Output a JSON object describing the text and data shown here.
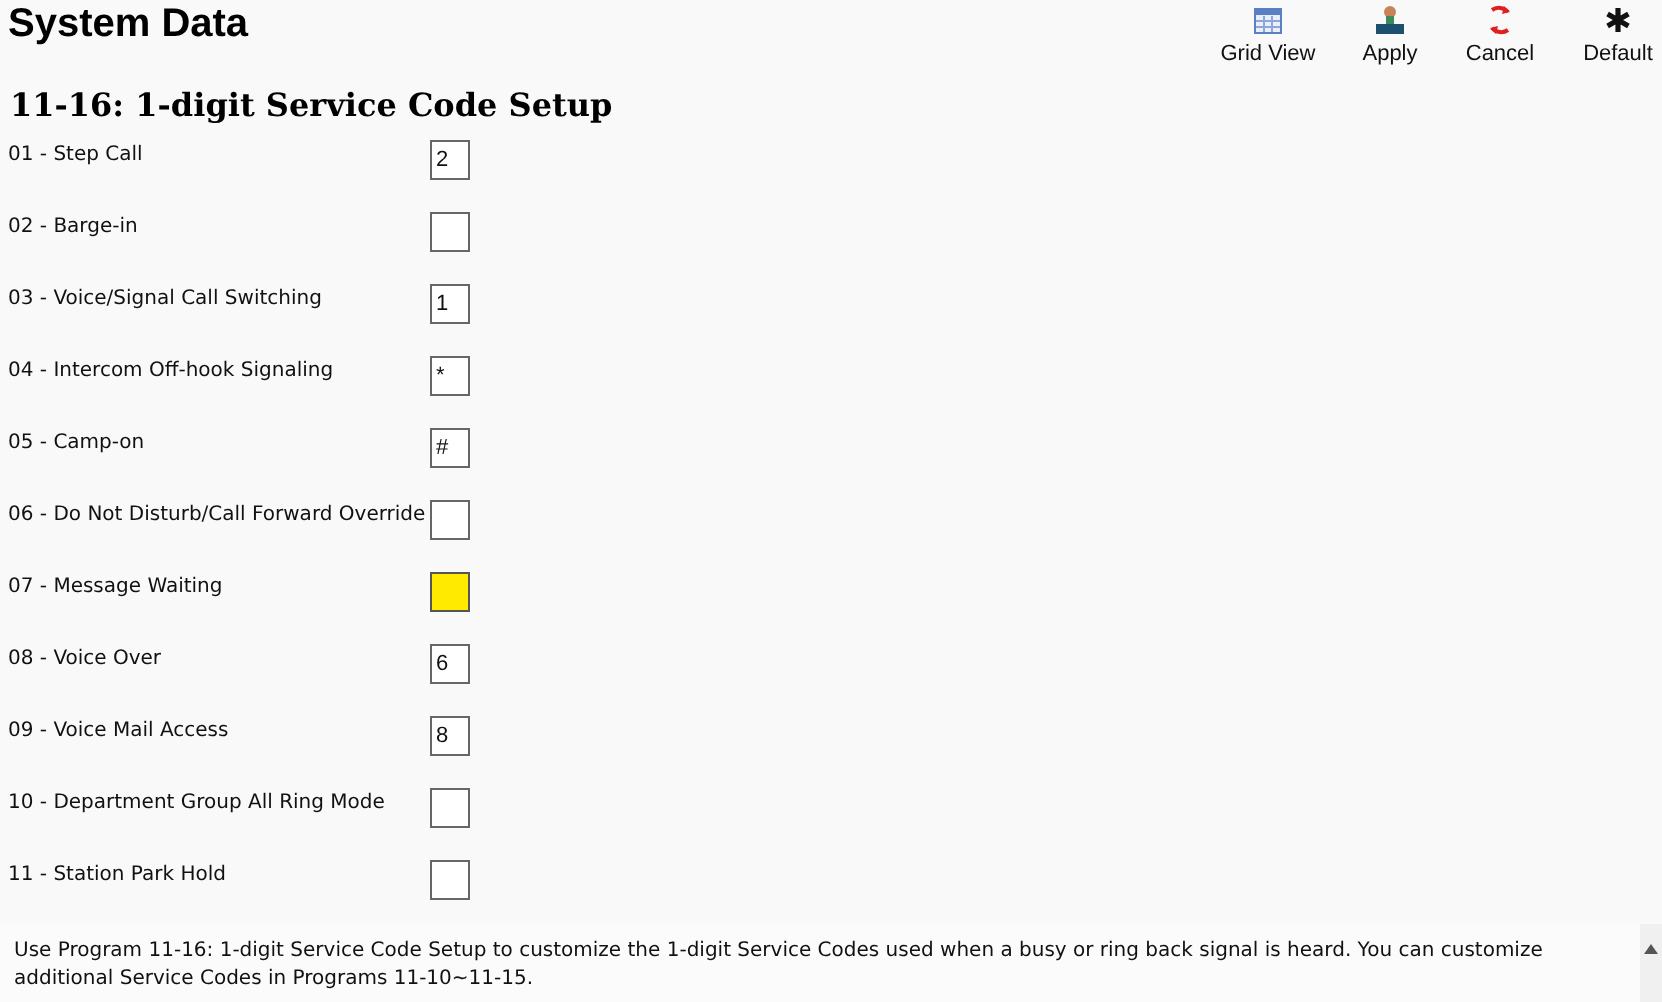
{
  "window": {
    "title": "System Data"
  },
  "toolbar": [
    {
      "kind": "grid",
      "label": "Grid View"
    },
    {
      "kind": "apply",
      "label": "Apply"
    },
    {
      "kind": "cancel",
      "label": "Cancel"
    },
    {
      "kind": "default",
      "label": "Default"
    }
  ],
  "section": {
    "title": "11-16: 1-digit Service Code Setup"
  },
  "fields": [
    {
      "label": "01 - Step Call",
      "value": "2",
      "highlighted": false
    },
    {
      "label": "02 - Barge-in",
      "highlighted": false
    },
    {
      "label": "03 - Voice/Signal Call Switching",
      "value": "1",
      "highlighted": false
    },
    {
      "label": "04 - Intercom Off-hook Signaling",
      "value": "*",
      "highlighted": false
    },
    {
      "label": "05 - Camp-on",
      "value": "#",
      "highlighted": false
    },
    {
      "label": "06 - Do Not Disturb/Call Forward Override",
      "highlighted": false
    },
    {
      "label": "07 - Message Waiting",
      "highlighted": true
    },
    {
      "label": "08 - Voice Over",
      "value": "6",
      "highlighted": false
    },
    {
      "label": "09 - Voice Mail Access",
      "value": "8",
      "highlighted": false
    },
    {
      "label": "10 - Department Group All Ring Mode",
      "highlighted": false
    },
    {
      "label": "11 - Station Park Hold",
      "highlighted": false
    }
  ],
  "help": "Use Program 11-16: 1-digit Service Code Setup to customize the 1-digit Service Codes used when a busy or ring back signal is heard. You can customize additional Service Codes in Programs 11-10~11-15."
}
